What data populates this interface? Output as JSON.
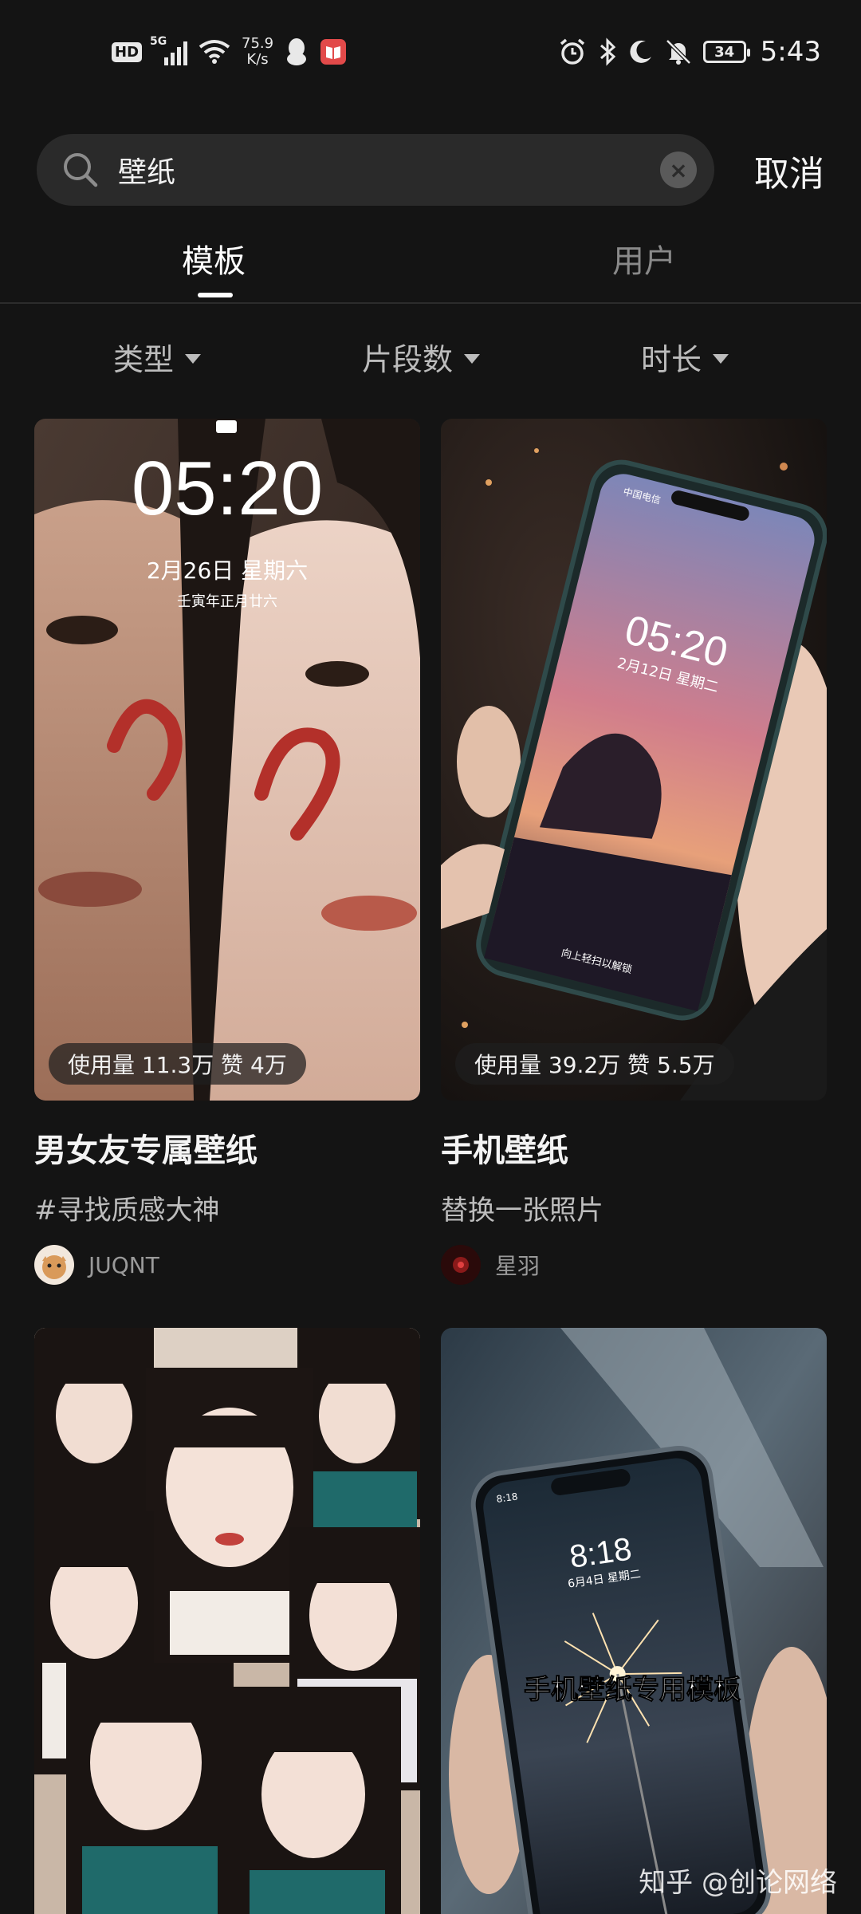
{
  "status_bar": {
    "hd": "HD",
    "network": "5G",
    "speed_value": "75.9",
    "speed_unit": "K/s",
    "battery": "34",
    "time": "5:43"
  },
  "search": {
    "query": "壁纸",
    "cancel_label": "取消"
  },
  "tabs": [
    {
      "label": "模板",
      "active": true
    },
    {
      "label": "用户",
      "active": false
    }
  ],
  "filters": [
    {
      "label": "类型"
    },
    {
      "label": "片段数"
    },
    {
      "label": "时长"
    }
  ],
  "cards": [
    {
      "stats": "使用量 11.3万 赞 4万",
      "title": "男女友专属壁纸",
      "subtitle": "#寻找质感大神",
      "author": "JUQNT",
      "lock_time": "05:20",
      "lock_date": "2月26日 星期六",
      "lock_lunar": "壬寅年正月廿六"
    },
    {
      "stats": "使用量 39.2万 赞 5.5万",
      "title": "手机壁纸",
      "subtitle": "替换一张照片",
      "author": "星羽",
      "phone_time": "05:20",
      "phone_date": "2月12日 星期二",
      "phone_carrier": "中国电信",
      "phone_unlock": "向上轻扫以解锁"
    },
    {
      "kind": "photo-collage"
    },
    {
      "overlay_text": "手机壁纸专用模板",
      "phone_time": "8:18",
      "phone_date": "6月4日 星期二",
      "phone_status_time": "8:18"
    }
  ],
  "watermark": "知乎 @创论网络"
}
